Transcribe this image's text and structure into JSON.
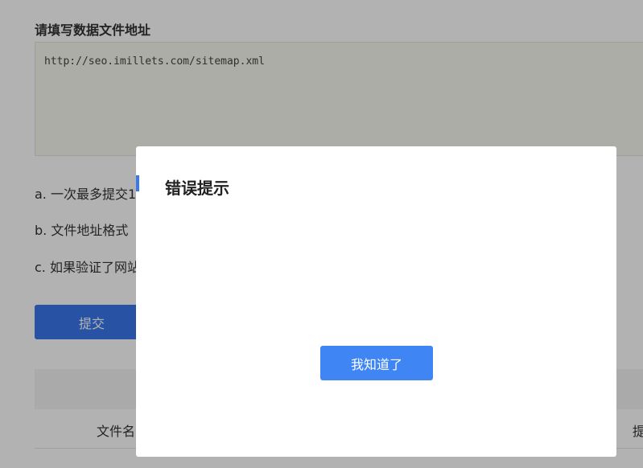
{
  "form": {
    "section_title": "请填写数据文件地址",
    "url_value": "http://seo.imillets.com/sitemap.xml",
    "rules": [
      "a. 一次最多提交1",
      "b. 文件地址格式",
      "c. 如果验证了网站"
    ],
    "submit_label": "提交"
  },
  "table": {
    "columns": [
      "文件名",
      "提"
    ]
  },
  "dialog": {
    "title": "错误提示",
    "button_label": "我知道了"
  },
  "colors": {
    "accent": "#3a78ec",
    "dialog_button": "#3f85f4"
  }
}
